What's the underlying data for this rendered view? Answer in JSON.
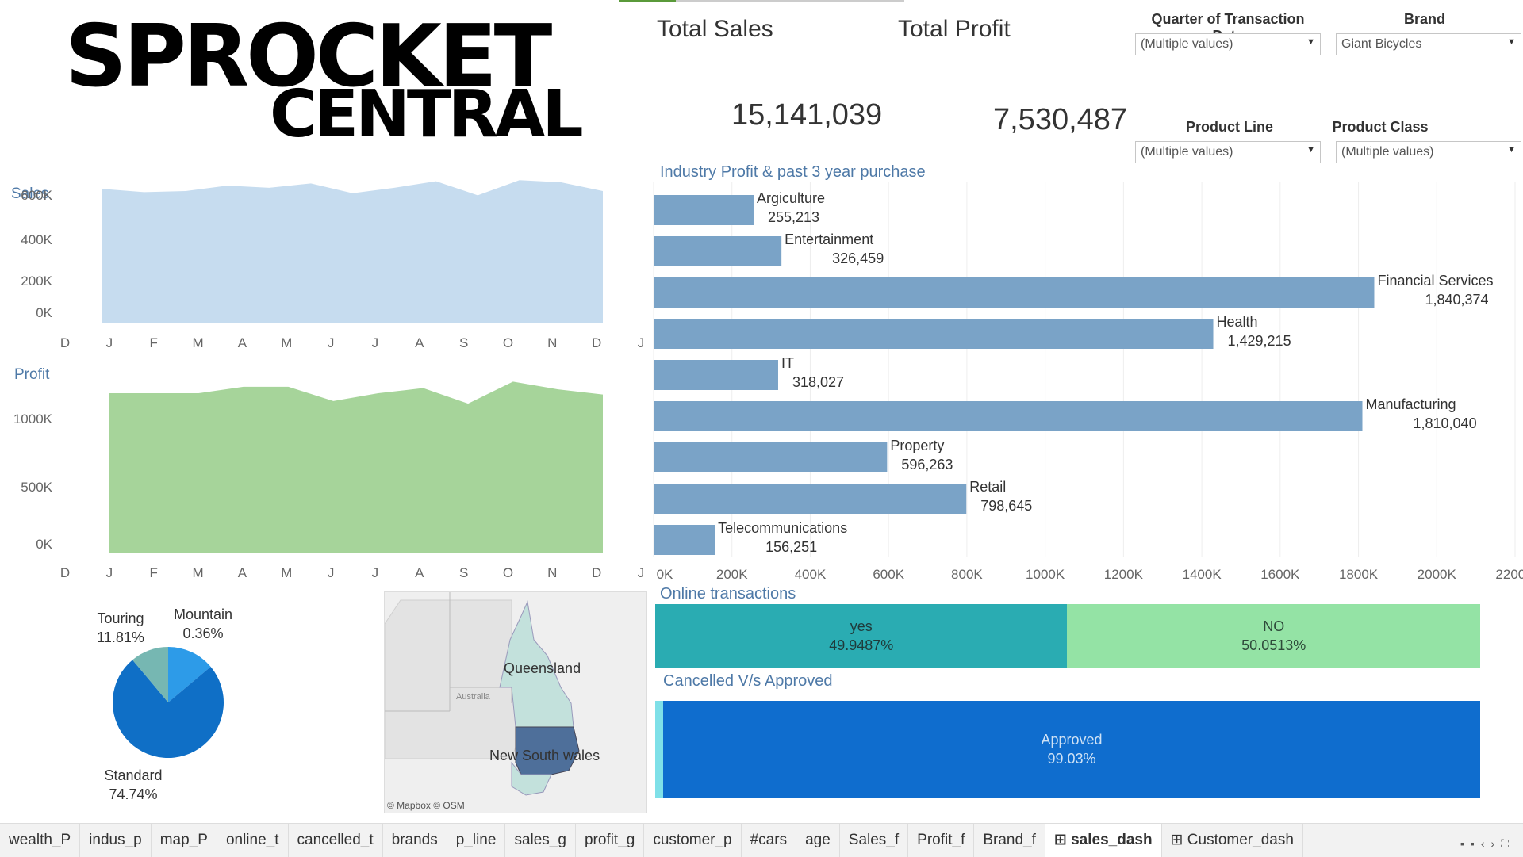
{
  "logo": {
    "line1": "SPROCKET",
    "line2": "CENTRAL"
  },
  "kpis": {
    "total_sales_label": "Total Sales",
    "total_sales_value": "15,141,039",
    "total_profit_label": "Total Profit",
    "total_profit_value": "7,530,487"
  },
  "filters": {
    "quarter": {
      "label": "Quarter of Transaction Date",
      "value": "(Multiple values)"
    },
    "brand": {
      "label": "Brand",
      "value": "Giant Bicycles"
    },
    "product_line": {
      "label": "Product Line",
      "value": "(Multiple values)"
    },
    "product_class": {
      "label": "Product Class",
      "value": "(Multiple values)"
    }
  },
  "sales_chart": {
    "title": "Sales",
    "y_ticks": [
      "600K",
      "400K",
      "200K",
      "0K"
    ],
    "months": [
      "D",
      "J",
      "F",
      "M",
      "A",
      "M",
      "J",
      "J",
      "A",
      "S",
      "O",
      "N",
      "D",
      "J"
    ],
    "values": [
      620,
      605,
      610,
      635,
      625,
      645,
      600,
      625,
      655,
      590,
      660,
      650,
      610
    ],
    "ymax": 650,
    "color": "#c6dcef"
  },
  "profit_chart": {
    "title": "Profit",
    "y_ticks": [
      "1000K",
      "500K",
      "0K"
    ],
    "months": [
      "D",
      "J",
      "F",
      "M",
      "A",
      "M",
      "J",
      "J",
      "A",
      "S",
      "O",
      "N",
      "D",
      "J"
    ],
    "values": [
      1240,
      1240,
      1240,
      1290,
      1290,
      1180,
      1240,
      1280,
      1160,
      1330,
      1270,
      1230
    ],
    "ymax": 1400,
    "color": "#a6d49a"
  },
  "chart_data": {
    "type": "bar",
    "title": "Industry Profit & past 3 year purchase",
    "categories": [
      "Argiculture",
      "Entertainment",
      "Financial Services",
      "Health",
      "IT",
      "Manufacturing",
      "Property",
      "Retail",
      "Telecommunications"
    ],
    "values": [
      255213,
      326459,
      1840374,
      1429215,
      318027,
      1810040,
      596263,
      798645,
      156251
    ],
    "value_labels": [
      "255,213",
      "326,459",
      "1,840,374",
      "1,429,215",
      "318,027",
      "1,810,040",
      "596,263",
      "798,645",
      "156,251"
    ],
    "x_ticks": [
      "0K",
      "200K",
      "400K",
      "600K",
      "800K",
      "1000K",
      "1200K",
      "1400K",
      "1600K",
      "1800K",
      "2000K",
      "2200K"
    ],
    "xlim": [
      0,
      2200000
    ],
    "orientation": "horizontal",
    "grid": true,
    "color": "#7aa3c7"
  },
  "pie": {
    "slices": [
      {
        "name": "Standard",
        "pct_label": "74.74%",
        "value": 74.74,
        "color": "#0f6fc6"
      },
      {
        "name": "Touring",
        "pct_label": "11.81%",
        "value": 11.81,
        "color": "#76b7b2"
      },
      {
        "name": "Mountain",
        "pct_label": "0.36%",
        "value": 0.36,
        "color": "#2d9be8"
      }
    ]
  },
  "map": {
    "label_country": "Australia",
    "regions": [
      "Queensland",
      "New South wales"
    ],
    "credit": "© Mapbox © OSM"
  },
  "online": {
    "title": "Online transactions",
    "yes": {
      "label": "yes",
      "pct": "49.9487%",
      "value": 49.9487,
      "color": "#2aacb2"
    },
    "no": {
      "label": "NO",
      "pct": "50.0513%",
      "value": 50.0513,
      "color": "#94e3a5"
    }
  },
  "cancelled": {
    "title": "Cancelled V/s Approved",
    "approved": {
      "label": "Approved",
      "pct": "99.03%",
      "value": 99.03,
      "color": "#0f6dce"
    },
    "cancelled_color": "#7fe0e8"
  },
  "tabs": [
    "wealth_P",
    "indus_p",
    "map_P",
    "online_t",
    "cancelled_t",
    "brands",
    "p_line",
    "sales_g",
    "profit_g",
    "customer_p",
    "#cars",
    "age",
    "Sales_f",
    "Profit_f",
    "Brand_f",
    "sales_dash",
    "Customer_dash"
  ],
  "active_tab": "sales_dash"
}
